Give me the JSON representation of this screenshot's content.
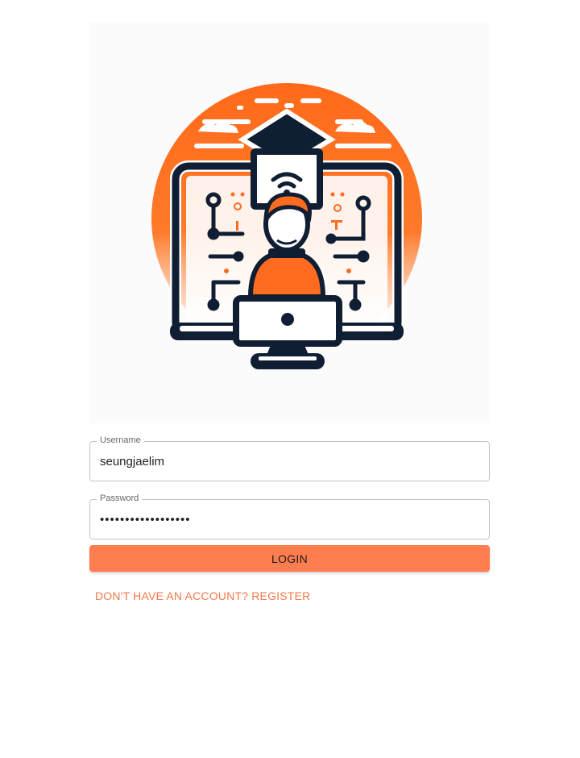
{
  "logo": {
    "icon": "elearning-logo-icon",
    "accent": "#ff6b1f",
    "dark": "#0f1e33"
  },
  "form": {
    "username": {
      "label": "Username",
      "value": "seungjaelim"
    },
    "password": {
      "label": "Password",
      "value": "••••••••••••••••••"
    },
    "login_label": "LOGIN",
    "register_label": "DON'T HAVE AN ACCOUNT? REGISTER"
  },
  "colors": {
    "button": "#ff7d4f",
    "link": "#f4784a",
    "border": "#c4c4c4"
  }
}
